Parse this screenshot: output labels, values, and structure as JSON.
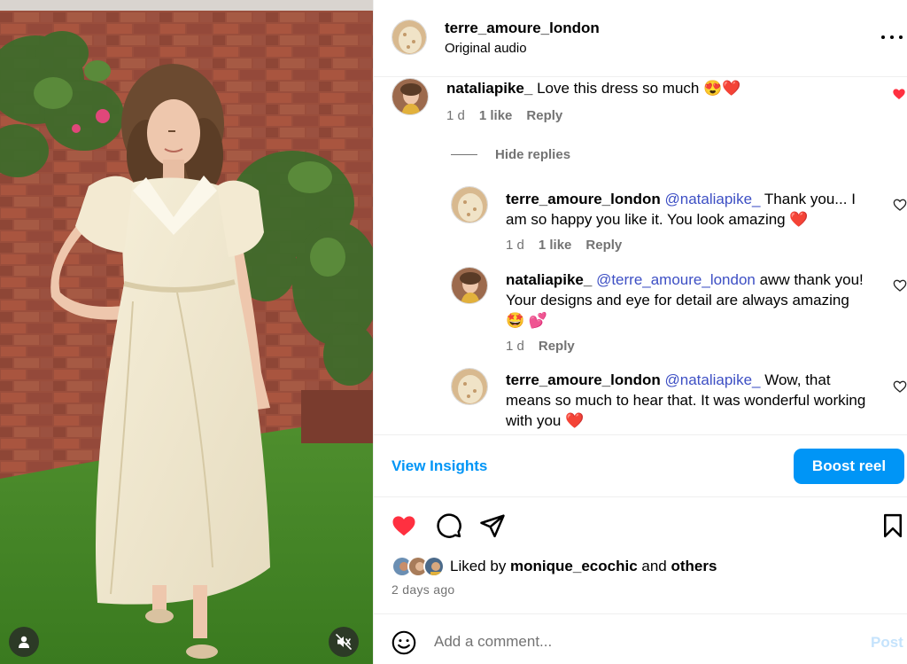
{
  "post": {
    "author": "terre_amoure_london",
    "audio": "Original audio",
    "more_icon": "more-horizontal-icon"
  },
  "comments": {
    "main": {
      "user": "nataliapike_",
      "text": "Love this dress so much 😍❤️",
      "age": "1 d",
      "likes": "1 like",
      "reply": "Reply",
      "liked": true
    },
    "hide_replies": "Hide replies",
    "replies": [
      {
        "user": "terre_amoure_london",
        "mention": "@nataliapike_",
        "text": " Thank you... I am so happy you like it. You look amazing ❤️",
        "age": "1 d",
        "likes": "1 like",
        "reply": "Reply"
      },
      {
        "user": "nataliapike_",
        "mention": "@terre_amoure_london",
        "text": " aww thank you! Your designs and eye for detail are always amazing 🤩 💕",
        "age": "1 d",
        "reply": "Reply"
      },
      {
        "user": "terre_amoure_london",
        "mention": "@nataliapike_",
        "text": " Wow, that means so much to hear that. It was wonderful working with you ❤️"
      }
    ]
  },
  "insights": {
    "view_label": "View Insights",
    "boost_label": "Boost reel"
  },
  "engagement": {
    "liked": true,
    "liked_by_prefix": "Liked by ",
    "liked_by_user": "monique_ecochic",
    "liked_by_and": " and ",
    "liked_by_others": "others",
    "date": "2 days ago"
  },
  "comment_box": {
    "placeholder": "Add a comment...",
    "post_label": "Post"
  },
  "colors": {
    "accent": "#0095f6",
    "heart": "#ff3040",
    "mention": "#3d4fc4",
    "muted": "#737373"
  }
}
